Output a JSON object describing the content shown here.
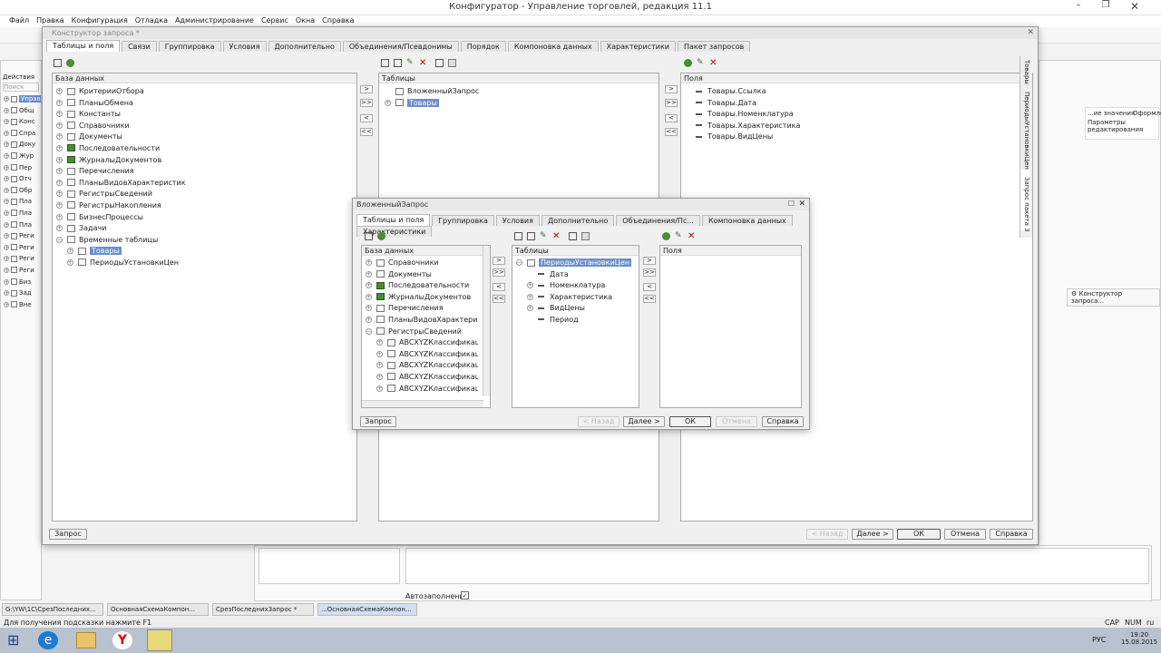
{
  "window": {
    "title": "Конфигуратор - Управление торговлей, редакция 11.1"
  },
  "menu": [
    "Файл",
    "Правка",
    "Конфигурация",
    "Отладка",
    "Администрирование",
    "Сервис",
    "Окна",
    "Справка"
  ],
  "left_pane": {
    "actions": "Действия",
    "search": "Поиск (Ctrl+...",
    "items": [
      "Управ",
      "Общ",
      "Конс",
      "Спра",
      "Доку",
      "Жур",
      "Пер",
      "Отч",
      "Обр",
      "Пла",
      "Пла",
      "Пла",
      "Реги",
      "Реги",
      "Реги",
      "Реги",
      "Биз",
      "Зад",
      "Вне"
    ]
  },
  "right_bg": {
    "header1": "...ие значения",
    "header2": "Оформление",
    "cell": "Параметры редактирования",
    "constructor_btn": "Конструктор запроса..."
  },
  "side_tabs": [
    "Товары",
    "ПериодыУстановкиЦен",
    "Запрос пакета 3"
  ],
  "main_dialog": {
    "title": "Конструктор запроса *",
    "tabs": [
      "Таблицы и поля",
      "Связи",
      "Группировка",
      "Условия",
      "Дополнительно",
      "Объединения/Псевдонимы",
      "Порядок",
      "Компоновка данных",
      "Характеристики",
      "Пакет запросов"
    ],
    "db_header": "База данных",
    "db_items": [
      "КритерииОтбора",
      "ПланыОбмена",
      "Константы",
      "Справочники",
      "Документы",
      "Последовательности",
      "ЖурналыДокументов",
      "Перечисления",
      "ПланыВидовХарактеристик",
      "РегистрыСведений",
      "РегистрыНакопления",
      "БизнесПроцессы",
      "Задачи",
      "Временные таблицы",
      "Товары",
      "ПериодыУстановкиЦен"
    ],
    "tables_header": "Таблицы",
    "tables": [
      "ВложенныйЗапрос",
      "Товары"
    ],
    "fields_header": "Поля",
    "fields": [
      "Товары.Ссылка",
      "Товары.Дата",
      "Товары.Номенклатура",
      "Товары.Характеристика",
      "Товары.ВидЦены"
    ],
    "buttons": {
      "query": "Запрос",
      "back": "< Назад",
      "next": "Далее >",
      "ok": "ОК",
      "cancel": "Отмена",
      "help": "Справка"
    }
  },
  "sub_dialog": {
    "title": "ВложенныйЗапрос",
    "tabs": [
      "Таблицы и поля",
      "Группировка",
      "Условия",
      "Дополнительно",
      "Объединения/Пс...",
      "Компоновка данных",
      "Характеристики"
    ],
    "db_header": "База данных",
    "db_items": [
      "Справочники",
      "Документы",
      "Последовательности",
      "ЖурналыДокументов",
      "Перечисления",
      "ПланыВидовХарактеристик",
      "РегистрыСведений",
      "ABCXYZКлассификацияК",
      "ABCXYZКлассификацияК",
      "ABCXYZКлассификацияК",
      "ABCXYZКлассификацияН",
      "ABCXYZКлассификацияН"
    ],
    "tables_header": "Таблицы",
    "tables": [
      "ПериодыУстановкиЦен",
      "Дата",
      "Номенклатура",
      "Характеристика",
      "ВидЦены",
      "Период"
    ],
    "fields_header": "Поля",
    "buttons": {
      "query": "Запрос",
      "back": "< Назад",
      "next": "Далее >",
      "ok": "ОК",
      "cancel": "Отмена",
      "help": "Справка"
    }
  },
  "autofill": {
    "label": "Автозаполнение",
    "checked": "✓"
  },
  "task_tabs": [
    "G:\\YW\\1С\\СрезПоследних...",
    "ОсновнаяСхемаКомпон...",
    "СрезПоследнихЗапрос *",
    "...ОсновнаяСхемаКомпон..."
  ],
  "status": {
    "hint": "Для получения подсказки нажмите F1",
    "cap": "CAP",
    "num": "NUM",
    "lang": "ru"
  },
  "tray": {
    "lang": "РУС",
    "time": "19:20",
    "date": "15.08.2015"
  }
}
